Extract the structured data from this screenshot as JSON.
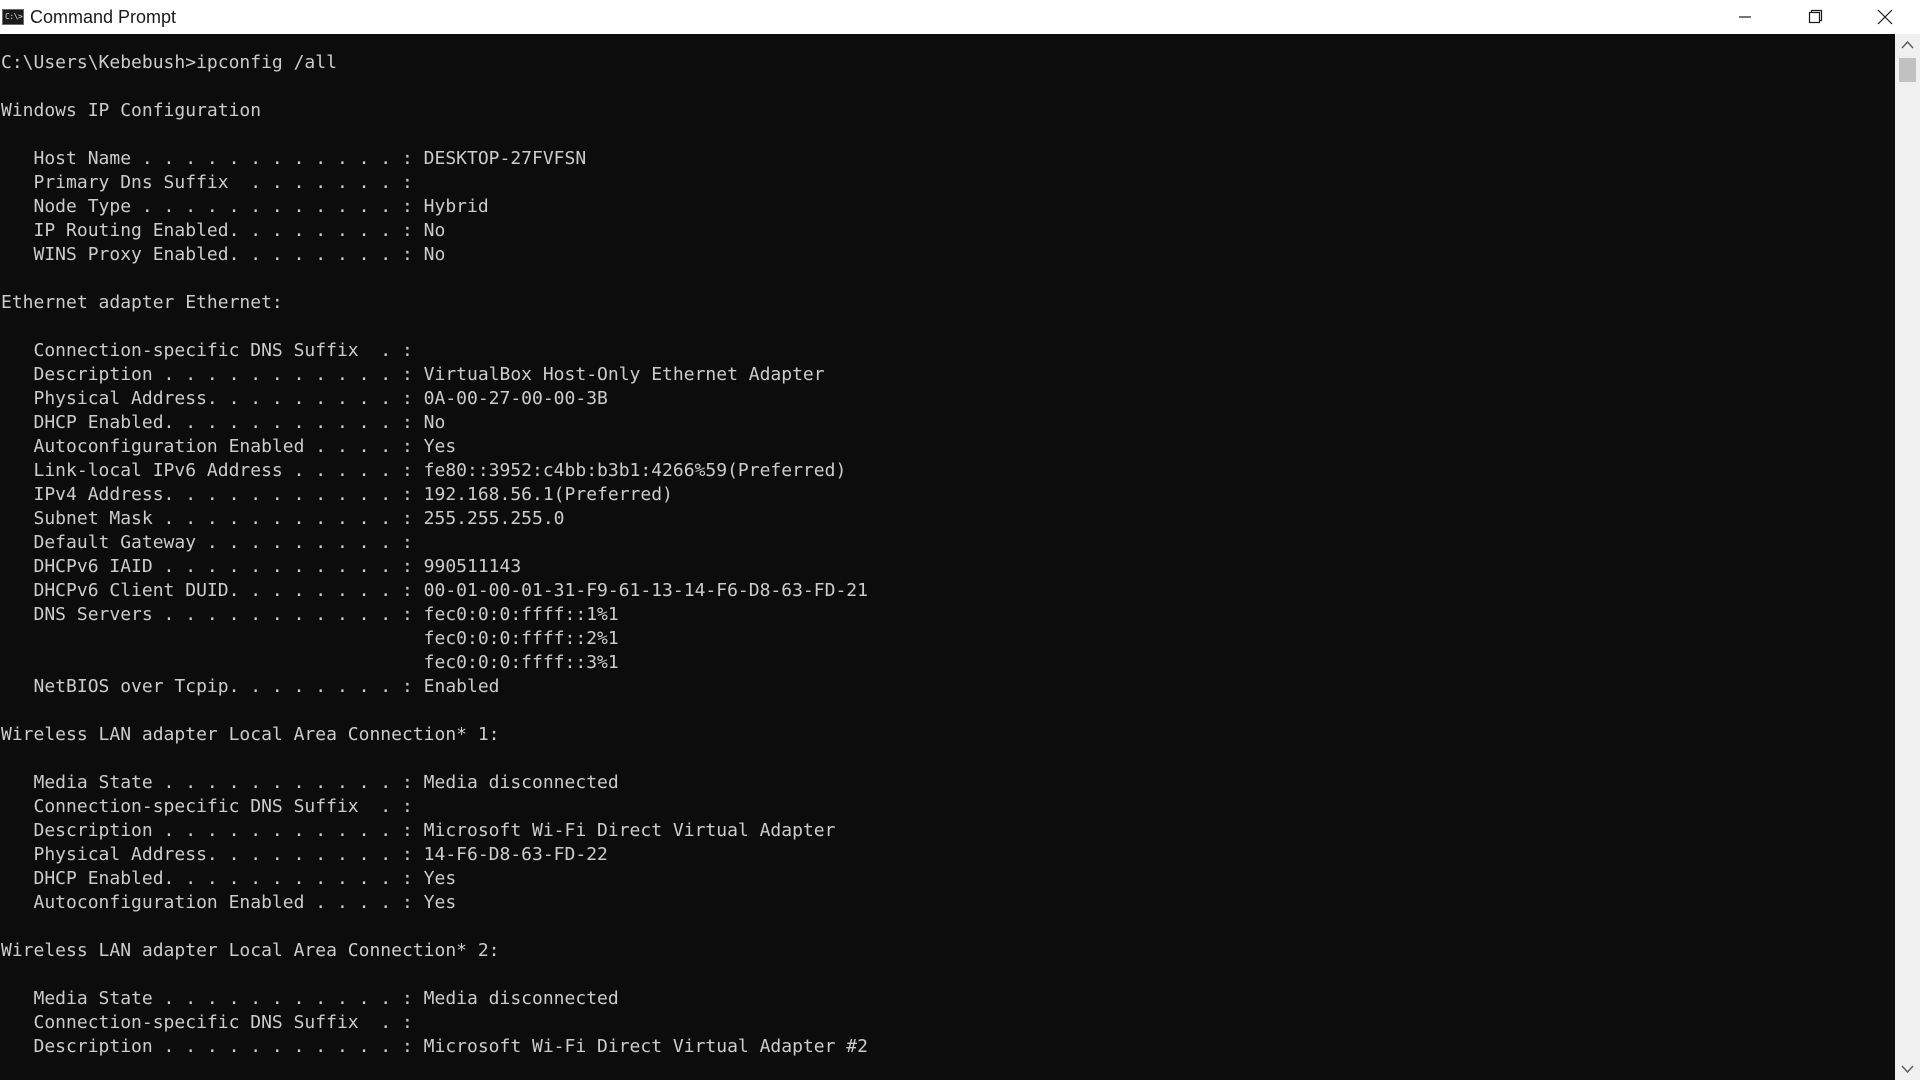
{
  "window": {
    "title": "Command Prompt",
    "icon_text": "C:\\>"
  },
  "controls": {
    "minimize": "minimize-icon",
    "restore": "restore-icon",
    "close": "close-icon"
  },
  "console": {
    "lines": [
      "C:\\Users\\Kebebush>ipconfig /all",
      "",
      "Windows IP Configuration",
      "",
      "   Host Name . . . . . . . . . . . . : DESKTOP-27FVFSN",
      "   Primary Dns Suffix  . . . . . . . :",
      "   Node Type . . . . . . . . . . . . : Hybrid",
      "   IP Routing Enabled. . . . . . . . : No",
      "   WINS Proxy Enabled. . . . . . . . : No",
      "",
      "Ethernet adapter Ethernet:",
      "",
      "   Connection-specific DNS Suffix  . :",
      "   Description . . . . . . . . . . . : VirtualBox Host-Only Ethernet Adapter",
      "   Physical Address. . . . . . . . . : 0A-00-27-00-00-3B",
      "   DHCP Enabled. . . . . . . . . . . : No",
      "   Autoconfiguration Enabled . . . . : Yes",
      "   Link-local IPv6 Address . . . . . : fe80::3952:c4bb:b3b1:4266%59(Preferred)",
      "   IPv4 Address. . . . . . . . . . . : 192.168.56.1(Preferred)",
      "   Subnet Mask . . . . . . . . . . . : 255.255.255.0",
      "   Default Gateway . . . . . . . . . :",
      "   DHCPv6 IAID . . . . . . . . . . . : 990511143",
      "   DHCPv6 Client DUID. . . . . . . . : 00-01-00-01-31-F9-61-13-14-F6-D8-63-FD-21",
      "   DNS Servers . . . . . . . . . . . : fec0:0:0:ffff::1%1",
      "                                       fec0:0:0:ffff::2%1",
      "                                       fec0:0:0:ffff::3%1",
      "   NetBIOS over Tcpip. . . . . . . . : Enabled",
      "",
      "Wireless LAN adapter Local Area Connection* 1:",
      "",
      "   Media State . . . . . . . . . . . : Media disconnected",
      "   Connection-specific DNS Suffix  . :",
      "   Description . . . . . . . . . . . : Microsoft Wi-Fi Direct Virtual Adapter",
      "   Physical Address. . . . . . . . . : 14-F6-D8-63-FD-22",
      "   DHCP Enabled. . . . . . . . . . . : Yes",
      "   Autoconfiguration Enabled . . . . : Yes",
      "",
      "Wireless LAN adapter Local Area Connection* 2:",
      "",
      "   Media State . . . . . . . . . . . : Media disconnected",
      "   Connection-specific DNS Suffix  . :",
      "   Description . . . . . . . . . . . : Microsoft Wi-Fi Direct Virtual Adapter #2"
    ]
  },
  "scrollbar": {
    "up": "scroll-up-arrow-icon",
    "down": "scroll-down-arrow-icon"
  }
}
